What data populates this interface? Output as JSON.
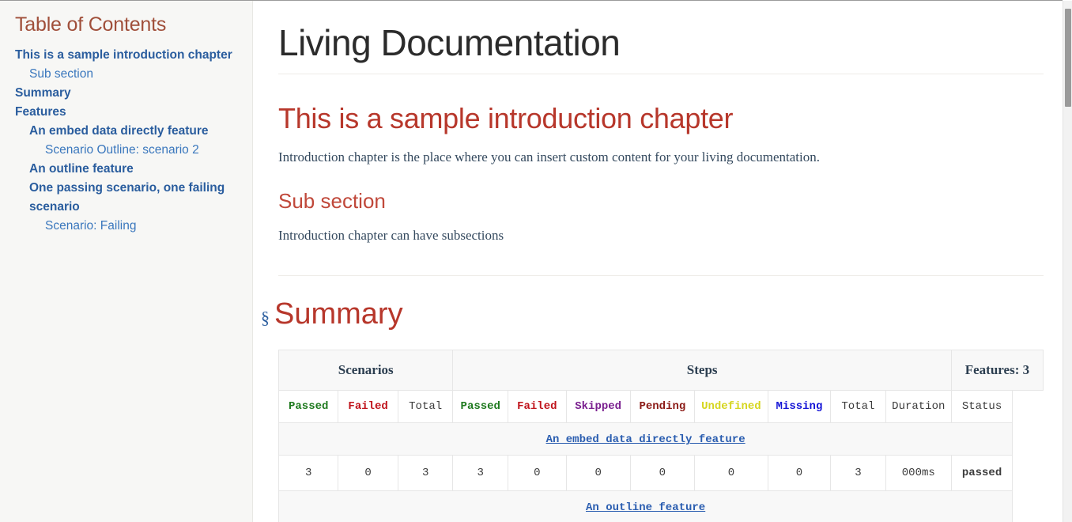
{
  "sidebar": {
    "title": "Table of Contents",
    "items": [
      {
        "label": "This is a sample introduction chapter",
        "level": 1
      },
      {
        "label": "Sub section",
        "level": 2
      },
      {
        "label": "Summary",
        "level": 1
      },
      {
        "label": "Features",
        "level": 1
      },
      {
        "label": "An embed data directly feature",
        "level": 2,
        "bold": true
      },
      {
        "label": "Scenario Outline: scenario 2",
        "level": 3
      },
      {
        "label": "An outline feature",
        "level": 2,
        "bold": true
      },
      {
        "label": "One passing scenario, one failing scenario",
        "level": 2,
        "bold": true
      },
      {
        "label": "Scenario: Failing",
        "level": 3
      }
    ]
  },
  "main": {
    "doc_title": "Living Documentation",
    "chapter_title": "This is a sample introduction chapter",
    "chapter_paragraph": "Introduction chapter is the place where you can insert custom content for your living documentation.",
    "subsection_title": "Sub section",
    "subsection_paragraph": "Introduction chapter can have subsections",
    "summary_anchor": "§",
    "summary_title": "Summary"
  },
  "summary_table": {
    "group_headers": [
      {
        "label": "Scenarios",
        "colspan": 3
      },
      {
        "label": "Steps",
        "colspan": 8
      },
      {
        "label": "Features: 3",
        "colspan": 2
      }
    ],
    "column_headers": [
      {
        "label": "Passed",
        "color_key": "c-passed",
        "bold": true
      },
      {
        "label": "Failed",
        "color_key": "c-failed",
        "bold": true
      },
      {
        "label": "Total",
        "color_key": "c-plain",
        "bold": false
      },
      {
        "label": "Passed",
        "color_key": "c-passed",
        "bold": true
      },
      {
        "label": "Failed",
        "color_key": "c-failed",
        "bold": true
      },
      {
        "label": "Skipped",
        "color_key": "c-skipped",
        "bold": true
      },
      {
        "label": "Pending",
        "color_key": "c-pending",
        "bold": true
      },
      {
        "label": "Undefined",
        "color_key": "c-undefined",
        "bold": true
      },
      {
        "label": "Missing",
        "color_key": "c-missing",
        "bold": true
      },
      {
        "label": "Total",
        "color_key": "c-plain",
        "bold": false
      },
      {
        "label": "Duration",
        "color_key": "c-plain",
        "bold": false
      },
      {
        "label": "Status",
        "color_key": "c-plain",
        "bold": false
      }
    ],
    "rows": [
      {
        "feature_name": "An embed data directly feature",
        "values": [
          "3",
          "0",
          "3",
          "3",
          "0",
          "0",
          "0",
          "0",
          "0",
          "3",
          "000ms"
        ],
        "status": "passed"
      },
      {
        "feature_name": "An outline feature",
        "values": [],
        "status": ""
      }
    ]
  },
  "colors": {
    "heading_red": "#b7372b",
    "toc_title": "#a04f3a",
    "link_blue": "#2a5d9e",
    "passed_green": "#1f7a1f",
    "failed_red": "#c0141c",
    "skipped_purple": "#7a1f8f",
    "pending_maroon": "#8b1a16",
    "undefined_yellow": "#d6d620",
    "missing_blue": "#1414d6",
    "sidebar_bg": "#f7f7f5"
  },
  "scrollbar": {
    "name": "vertical-scrollbar"
  }
}
